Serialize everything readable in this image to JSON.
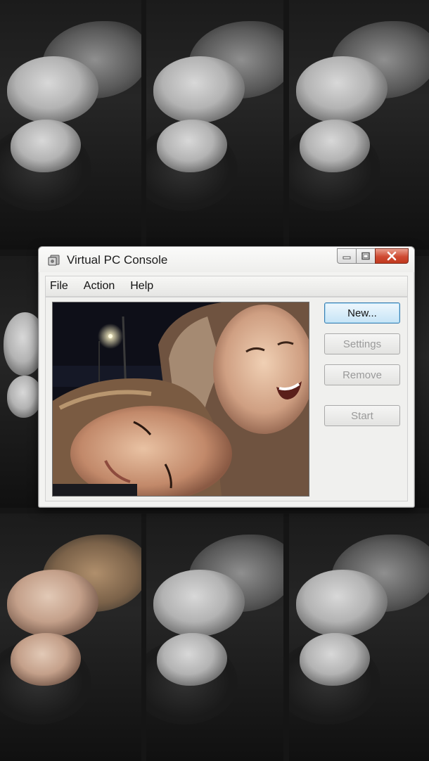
{
  "window": {
    "title": "Virtual PC Console",
    "icon": "virtual-pc-icon"
  },
  "menubar": {
    "items": [
      "File",
      "Action",
      "Help"
    ]
  },
  "buttons": {
    "new": "New...",
    "settings": "Settings",
    "remove": "Remove",
    "start": "Start"
  },
  "colors": {
    "accent": "#c6e4f6",
    "close": "#c0391f"
  }
}
